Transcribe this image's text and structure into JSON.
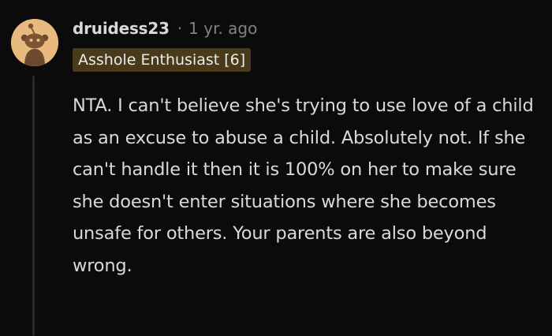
{
  "comment": {
    "author": "druidess23",
    "separator": "·",
    "timestamp": "1 yr. ago",
    "flair": "Asshole Enthusiast [6]",
    "body": "NTA. I can't believe she's trying to use love of a child as an excuse to abuse a child. Absolutely not. If she can't handle it then it is 100% on her to make sure she doesn't enter situations where she becomes unsafe for others. Your parents are also beyond wrong."
  },
  "colors": {
    "background": "#0b0b0b",
    "text": "#d7dadc",
    "muted": "#818384",
    "avatar_bg": "#e9ba7f",
    "flair_bg": "#4a3a1c"
  },
  "icons": {
    "avatar": "default-snoo-avatar-icon"
  }
}
